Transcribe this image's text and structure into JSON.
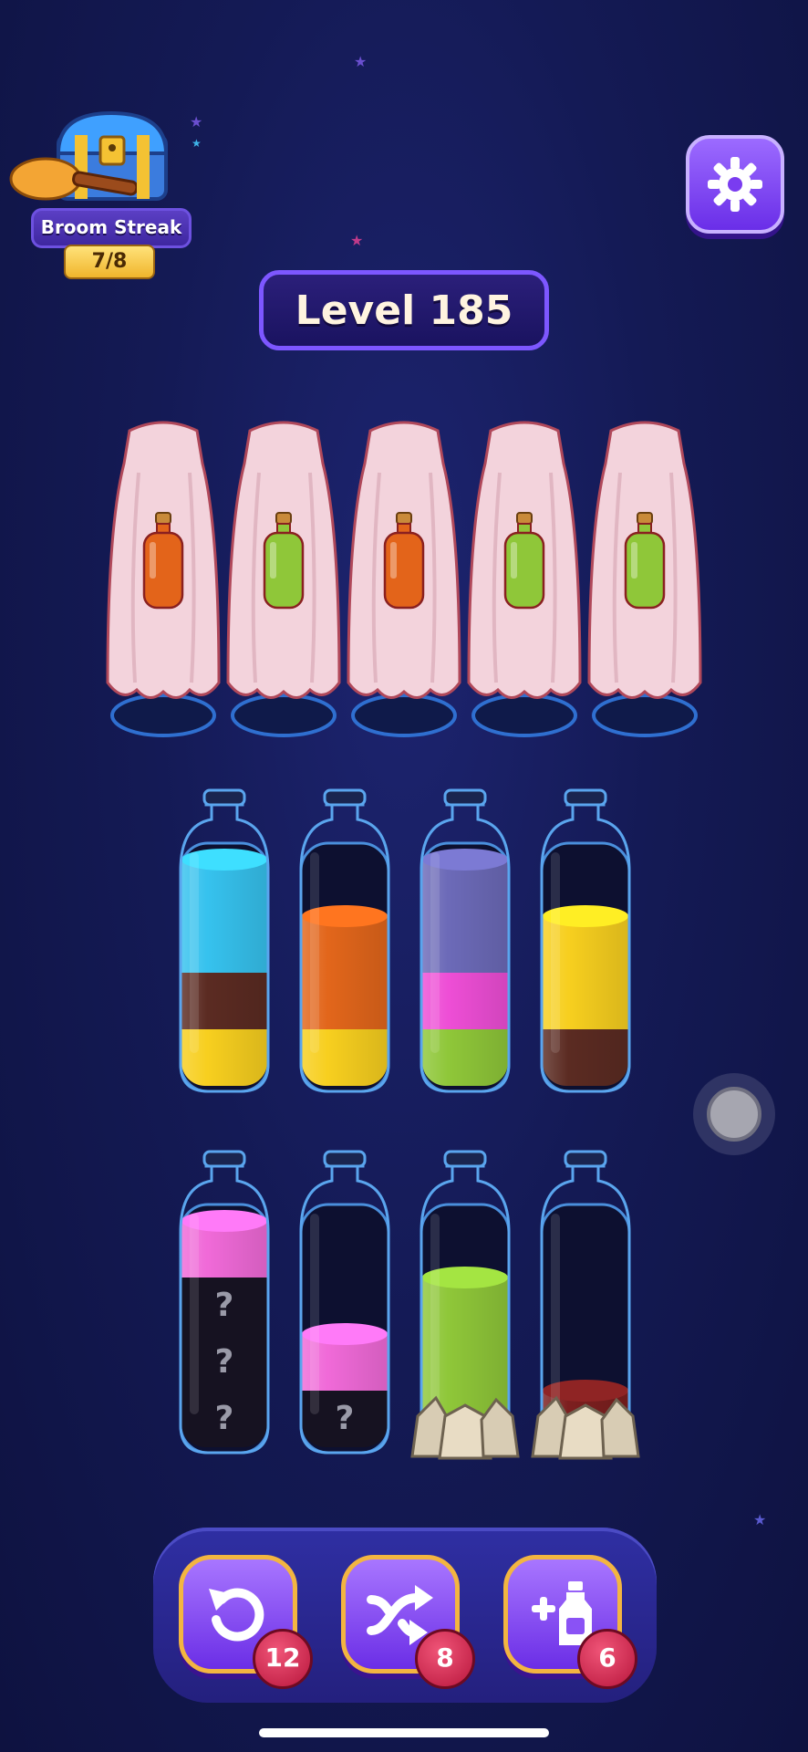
{
  "streak": {
    "label": "Broom Streak",
    "count": "7/8"
  },
  "level": {
    "label": "Level 185"
  },
  "hidden_potions": [
    "#e3641a",
    "#8fc739",
    "#e3641a",
    "#8fc739",
    "#8fc739"
  ],
  "bottles": [
    {
      "layers": [
        {
          "color": "#36c2ee",
          "units": 2
        },
        {
          "color": "#5b2b22",
          "units": 1
        },
        {
          "color": "#f7cf1f",
          "units": 1
        }
      ],
      "hidden": 0,
      "rocks": false
    },
    {
      "layers": [
        {
          "color": "#e2661b",
          "units": 2
        },
        {
          "color": "#f7cf1f",
          "units": 1
        }
      ],
      "hidden": 0,
      "rocks": false
    },
    {
      "layers": [
        {
          "color": "#6c6ab8",
          "units": 2
        },
        {
          "color": "#ee4ed6",
          "units": 1
        },
        {
          "color": "#8fc739",
          "units": 1
        }
      ],
      "hidden": 0,
      "rocks": false
    },
    {
      "layers": [
        {
          "color": "#f7cf1f",
          "units": 2
        },
        {
          "color": "#5b2b22",
          "units": 1
        }
      ],
      "hidden": 0,
      "rocks": false
    },
    {
      "layers": [
        {
          "color": "#f06ad8",
          "units": 1
        }
      ],
      "hidden": 3,
      "rocks": false
    },
    {
      "layers": [
        {
          "color": "#f06ad8",
          "units": 1
        }
      ],
      "hidden": 1,
      "rocks": false
    },
    {
      "layers": [
        {
          "color": "#8fc739",
          "units": 3
        }
      ],
      "hidden": 0,
      "rocks": true
    },
    {
      "layers": [
        {
          "color": "#7c1f1f",
          "units": 1
        }
      ],
      "hidden": 0,
      "rocks": true
    }
  ],
  "hidden_mark": "?",
  "tools": [
    {
      "name": "undo",
      "count": "12"
    },
    {
      "name": "shuffle",
      "count": "8"
    },
    {
      "name": "add-bottle",
      "count": "6"
    }
  ],
  "icons": [
    "gear-icon",
    "undo-icon",
    "shuffle-icon",
    "add-bottle-icon",
    "treasure-chest-icon"
  ]
}
